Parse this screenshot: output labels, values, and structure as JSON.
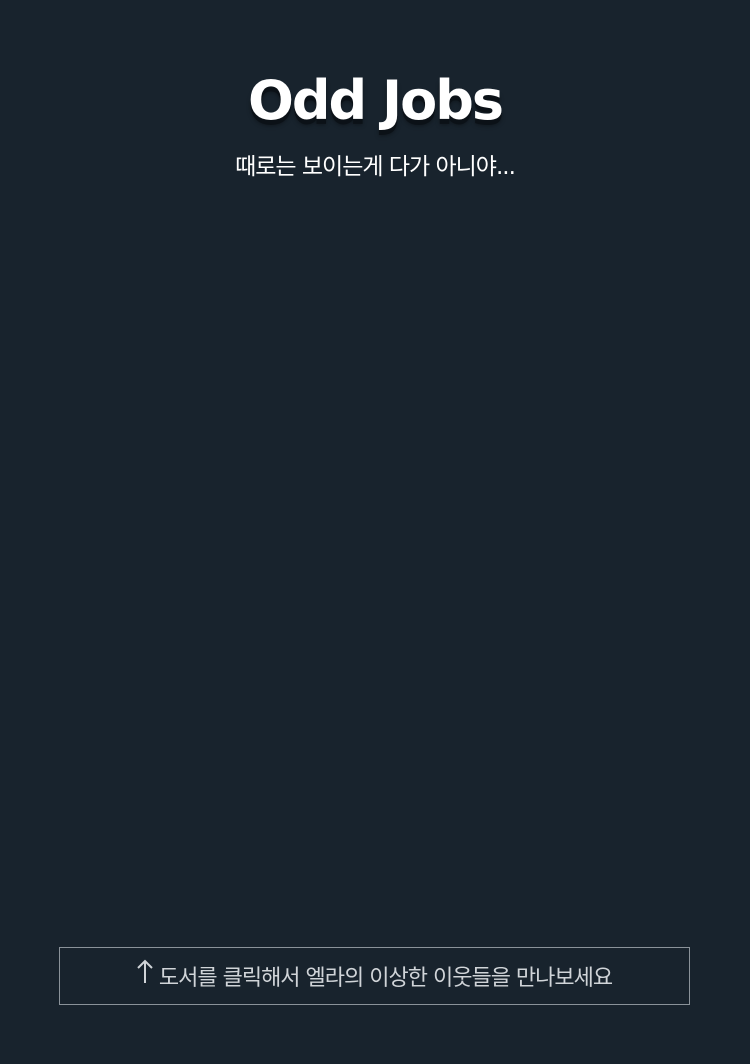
{
  "header": {
    "title": "Odd Jobs",
    "subtitle": "때로는 보이는게 다가 아니야..."
  },
  "cta": {
    "icon": "arrow-up-icon",
    "label": "도서를 클릭해서 엘라의 이상한 이웃들을 만나보세요"
  },
  "colors": {
    "background": "#18232d",
    "text": "#ffffff",
    "cta_border": "#8a9299",
    "cta_text": "#d0d4d8"
  }
}
